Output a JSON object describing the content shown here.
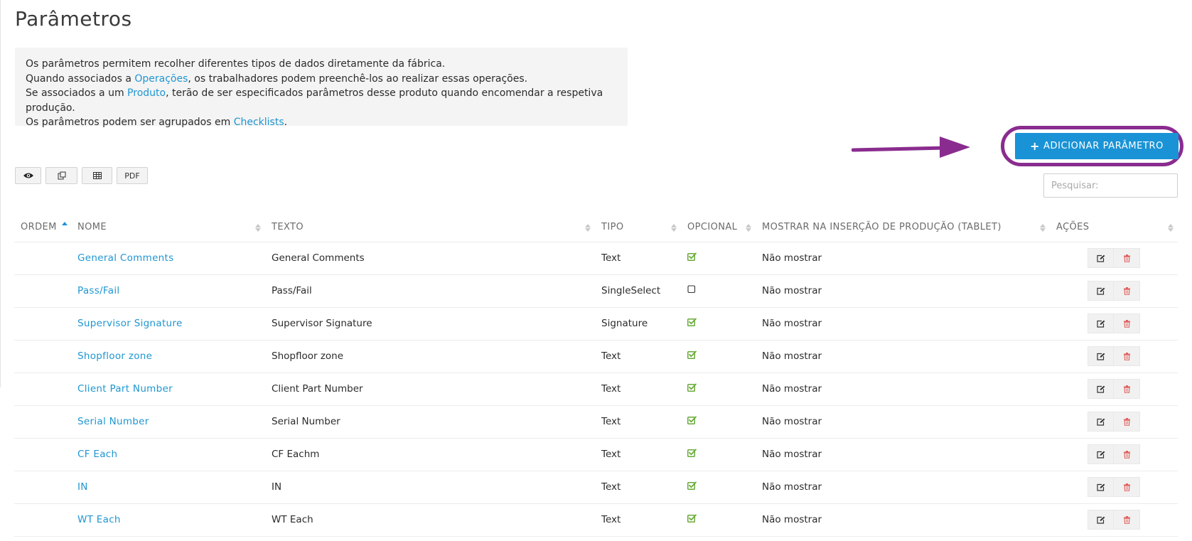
{
  "page": {
    "title": "Parâmetros"
  },
  "info": {
    "line1": "Os parâmetros permitem recolher diferentes tipos de dados diretamente da fábrica.",
    "line2_before": "Quando associados a ",
    "line2_link": "Operações",
    "line2_after": ", os trabalhadores podem preenchê-los ao realizar essas operações.",
    "line3_before": "Se associados a um ",
    "line3_link": "Produto",
    "line3_after": ", terão de ser especificados parâmetros desse produto quando encomendar a respetiva produção.",
    "line4_before": "Os parâmetros podem ser agrupados em ",
    "line4_link": "Checklists",
    "line4_after": "."
  },
  "actions": {
    "add_label": "ADICIONAR PARÂMETRO",
    "search_placeholder": "Pesquisar:"
  },
  "toolbar": {
    "pdf_label": "PDF"
  },
  "table": {
    "columns": {
      "ordem": "ORDEM",
      "nome": "NOME",
      "texto": "TEXTO",
      "tipo": "TIPO",
      "opcional": "OPCIONAL",
      "mostrar": "MOSTRAR NA INSERÇÃO DE PRODUÇÃO (TABLET)",
      "acoes": "AÇÕES"
    },
    "rows": [
      {
        "nome": "General Comments",
        "texto": "General Comments",
        "tipo": "Text",
        "opcional": true,
        "mostrar": "Não mostrar"
      },
      {
        "nome": "Pass/Fail",
        "texto": "Pass/Fail",
        "tipo": "SingleSelect",
        "opcional": false,
        "mostrar": "Não mostrar"
      },
      {
        "nome": "Supervisor Signature",
        "texto": "Supervisor Signature",
        "tipo": "Signature",
        "opcional": true,
        "mostrar": "Não mostrar"
      },
      {
        "nome": "Shopfloor zone",
        "texto": "Shopfloor zone",
        "tipo": "Text",
        "opcional": true,
        "mostrar": "Não mostrar"
      },
      {
        "nome": "Client Part Number",
        "texto": "Client Part Number",
        "tipo": "Text",
        "opcional": true,
        "mostrar": "Não mostrar"
      },
      {
        "nome": "Serial Number",
        "texto": "Serial Number",
        "tipo": "Text",
        "opcional": true,
        "mostrar": "Não mostrar"
      },
      {
        "nome": "CF Each",
        "texto": "CF Eachm",
        "tipo": "Text",
        "opcional": true,
        "mostrar": "Não mostrar"
      },
      {
        "nome": "IN",
        "texto": "IN",
        "tipo": "Text",
        "opcional": true,
        "mostrar": "Não mostrar"
      },
      {
        "nome": "WT Each",
        "texto": "WT Each",
        "tipo": "Text",
        "opcional": true,
        "mostrar": "Não mostrar"
      }
    ]
  },
  "colors": {
    "accent": "#1a93d6",
    "link": "#1f96d1",
    "annotation": "#8a2c8f",
    "check": "#6aaa3a",
    "delete": "#e0605e"
  },
  "icons": {
    "view": "eye-icon",
    "copy": "copy-icon",
    "excel": "table-icon",
    "edit": "edit-icon",
    "delete": "trash-icon",
    "checked": "checked-box-icon",
    "unchecked": "unchecked-box-icon"
  }
}
